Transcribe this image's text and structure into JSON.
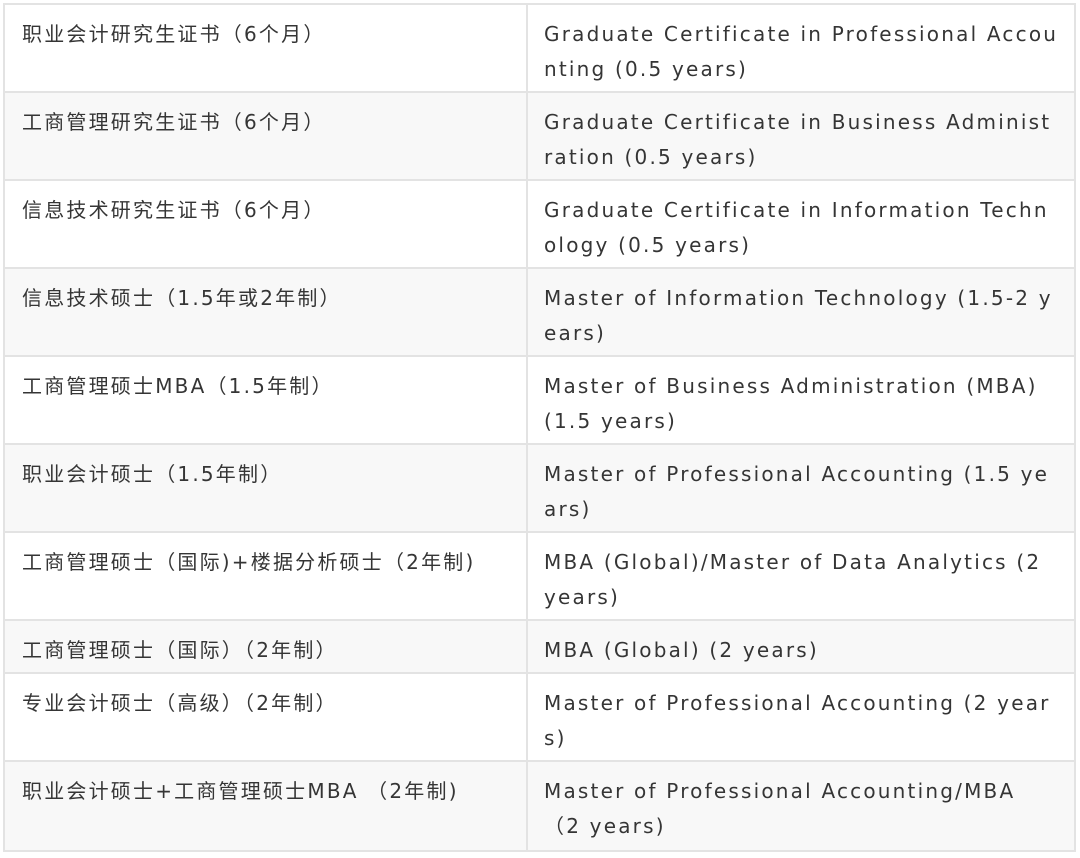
{
  "table": {
    "rows": [
      {
        "zh": "职业会计研究生证书（6个月）",
        "en": "Graduate Certificate in Professional Accounting (0.5 years)"
      },
      {
        "zh": "工商管理研究生证书（6个月）",
        "en": "Graduate Certificate in Business Administration (0.5 years)"
      },
      {
        "zh": "信息技术研究生证书（6个月）",
        "en": "Graduate Certificate in Information Technology (0.5 years)"
      },
      {
        "zh": "信息技术硕士（1.5年或2年制）",
        "en": "Master of Information Technology (1.5-2 years)"
      },
      {
        "zh": "工商管理硕士MBA（1.5年制）",
        "en": "Master of Business Administration (MBA) (1.5 years)"
      },
      {
        "zh": "职业会计硕士（1.5年制）",
        "en": "Master of Professional Accounting (1.5 years)"
      },
      {
        "zh": "工商管理硕士（国际)+楼据分析硕士（2年制)",
        "en": "MBA (Global)/Master of Data Analytics (2 years)"
      },
      {
        "zh": "工商管理硕士（国际）（2年制）",
        "en": "MBA (Global) (2 years)"
      },
      {
        "zh": "专业会计硕士（高级）（2年制）",
        "en": "Master of Professional Accounting (2 years)"
      },
      {
        "zh": "职业会计硕士+工商管理硕士MBA （2年制)",
        "en": "Master of Professional Accounting/MBA （2 years)"
      }
    ]
  }
}
